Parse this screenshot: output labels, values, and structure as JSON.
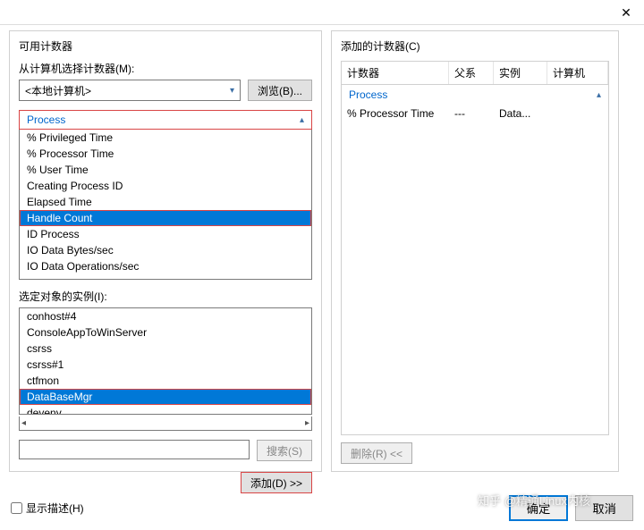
{
  "titlebar": {
    "close": "✕"
  },
  "left": {
    "title": "可用计数器",
    "computer_label": "从计算机选择计数器(M):",
    "computer_value": "<本地计算机>",
    "browse_btn": "浏览(B)...",
    "counter_group": "Process",
    "counters": [
      "% Privileged Time",
      "% Processor Time",
      "% User Time",
      "Creating Process ID",
      "Elapsed Time",
      "Handle Count",
      "ID Process",
      "IO Data Bytes/sec",
      "IO Data Operations/sec"
    ],
    "selected_counter_index": 5,
    "instance_label": "选定对象的实例(I):",
    "instances": [
      "conhost#4",
      "ConsoleAppToWinServer",
      "csrss",
      "csrss#1",
      "ctfmon",
      "DataBaseMgr",
      "devenv"
    ],
    "selected_instance_index": 5,
    "search_btn": "搜索(S)",
    "add_btn": "添加(D) >>"
  },
  "right": {
    "title": "添加的计数器(C)",
    "columns": [
      "计数器",
      "父系",
      "实例",
      "计算机"
    ],
    "group": "Process",
    "rows": [
      {
        "counter": "% Processor Time",
        "parent": "---",
        "instance": "Data...",
        "computer": ""
      }
    ],
    "remove_btn": "删除(R) <<"
  },
  "bottom": {
    "show_desc": "显示描述(H)",
    "ok": "确定",
    "cancel": "取消"
  },
  "watermark": "知乎 @精通Linux内核"
}
